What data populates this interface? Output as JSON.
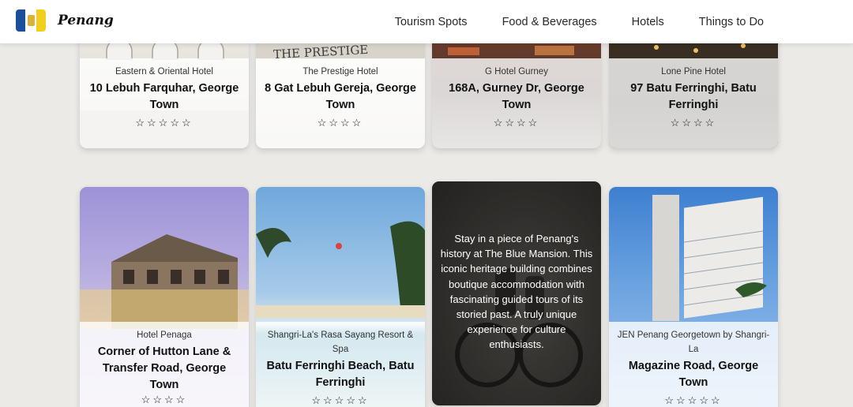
{
  "header": {
    "brand": "Penang",
    "nav": [
      "Tourism Spots",
      "Food & Beverages",
      "Hotels",
      "Things to Do"
    ]
  },
  "hotels_row1": [
    {
      "name": "Eastern & Oriental Hotel",
      "address": "10 Lebuh Farquhar, George Town",
      "stars": "☆☆☆☆☆",
      "rating": 5
    },
    {
      "name": "The Prestige Hotel",
      "address": "8 Gat Lebuh Gereja, George Town",
      "stars": "☆☆☆☆",
      "rating": 4,
      "sign": "THE PRESTIGE"
    },
    {
      "name": "G Hotel Gurney",
      "address": "168A, Gurney Dr, George Town",
      "stars": "☆☆☆☆",
      "rating": 4
    },
    {
      "name": "Lone Pine Hotel",
      "address": "97 Batu Ferringhi, Batu Ferringhi",
      "stars": "☆☆☆☆",
      "rating": 4
    }
  ],
  "hotels_row2": [
    {
      "name": "Hotel Penaga",
      "address": "Corner of Hutton Lane & Transfer Road, George Town",
      "stars": "☆☆☆☆",
      "rating": 4
    },
    {
      "name": "Shangri-La's Rasa Sayang Resort & Spa",
      "address": "Batu Ferringhi Beach, Batu Ferringhi",
      "stars": "☆☆☆☆☆",
      "rating": 5
    },
    {
      "description": "Stay in a piece of Penang's history at The Blue Mansion. This iconic heritage building combines boutique accommodation with fascinating guided tours of its storied past. A truly unique experience for culture enthusiasts."
    },
    {
      "name": "JEN Penang Georgetown by Shangri-La",
      "address": "Magazine Road, George Town",
      "stars": "☆☆☆☆☆",
      "rating": 5
    }
  ]
}
